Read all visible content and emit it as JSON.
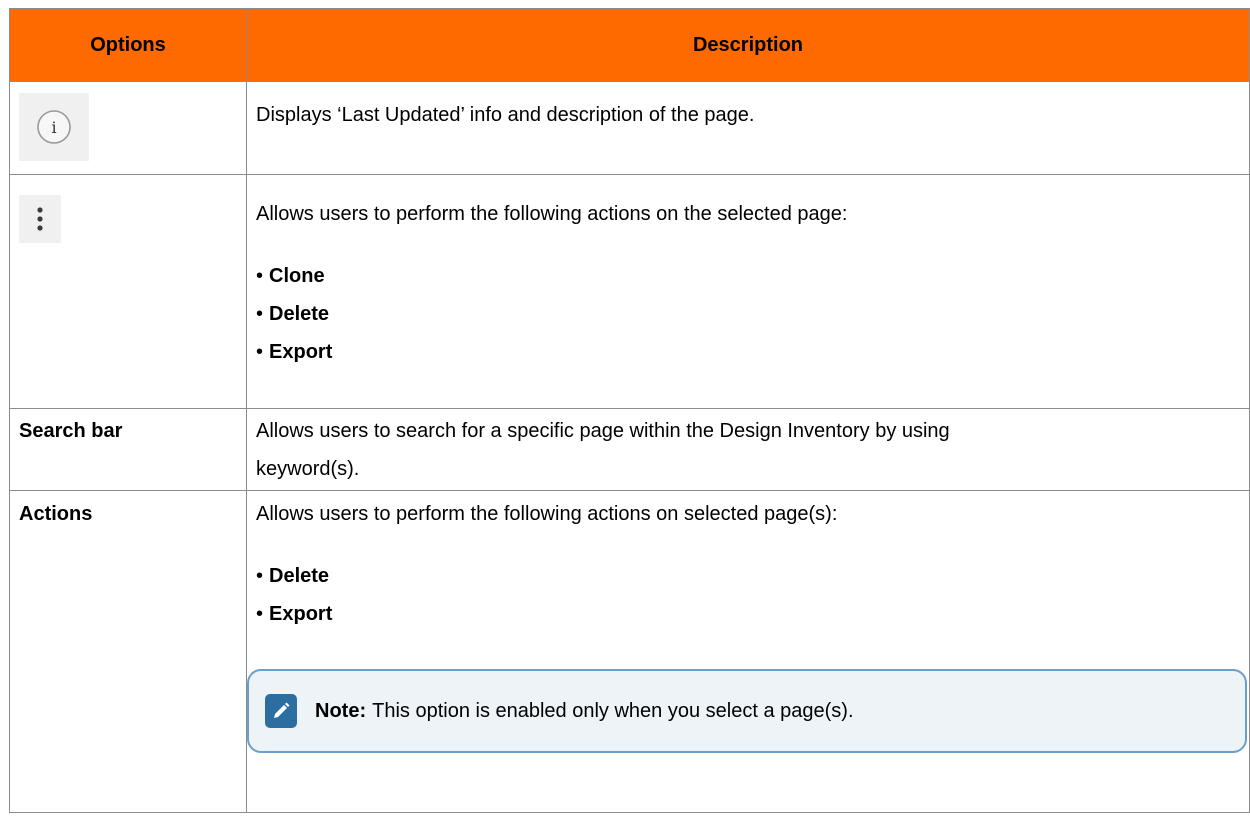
{
  "header": {
    "col1": "Options",
    "col2": "Description"
  },
  "rows": [
    {
      "option_icon": "info-circle-icon",
      "description": "Displays ‘Last Updated’ info and description of the page."
    },
    {
      "option_icon": "vertical-ellipsis-icon",
      "description": "Allows users to perform the following actions on the selected page:",
      "bullets": [
        "Clone",
        "Delete",
        "Export"
      ]
    },
    {
      "option_label": "Search bar",
      "description_lines": [
        "Allows users to search for a specific page within the Design Inventory by using",
        "keyword(s)."
      ]
    },
    {
      "option_label": "Actions",
      "description": "Allows users to perform the following actions on selected page(s):",
      "bullets": [
        "Delete",
        "Export"
      ],
      "note": {
        "label": "Note:",
        "text": "This option is enabled only when you select a page(s).",
        "icon": "pencil-note-icon"
      }
    }
  ],
  "colors": {
    "header_bg": "#ff6a00",
    "note_bg": "#eef3f8",
    "note_border": "#6aa0c8",
    "note_icon": "#2c6ea0"
  }
}
